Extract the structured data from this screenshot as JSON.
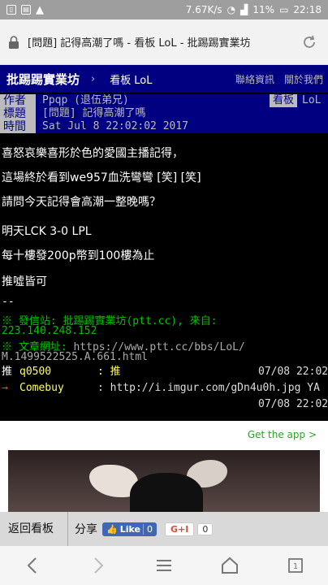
{
  "status": {
    "speed": "7.67K/s",
    "battery": "11%",
    "time": "22:18"
  },
  "browser": {
    "url_title": "[問題] 記得高潮了嗎 - 看板 LoL - 批踢踢實業坊"
  },
  "header": {
    "site": "批踢踢實業坊",
    "sep": "›",
    "board_prefix": "看板",
    "board": "LoL",
    "links": [
      "聯絡資訊",
      "關於我們"
    ]
  },
  "meta": {
    "author_tag": "作者",
    "author": "Ppqp (退伍弟兄)",
    "board_tag": "看板",
    "board": "LoL",
    "title_tag": "標題",
    "title": "[問題] 記得高潮了嗎",
    "time_tag": "時間",
    "time": "Sat Jul  8 22:02:02 2017"
  },
  "body": {
    "lines": [
      "喜怒哀樂喜形於色的愛國主播記得，",
      "這場終於看到we957血洗彎彎 [笑] [笑]",
      "請問今天記得會高潮一整晚嗎？",
      "明天LCK 3-0 LPL",
      "每十樓發200p幣到100樓為止",
      "推噓皆可"
    ],
    "sig": "--",
    "from_line": "※ 發信站: 批踢踢實業坊(ptt.cc), 來自:",
    "ip": "223.140.248.152",
    "url_label": "※ 文章網址:",
    "url": "https://www.ptt.cc/bbs/LoL/",
    "url2": "M.1499522525.A.661.html"
  },
  "pushes": [
    {
      "tag": "推",
      "user": "q0500",
      "text": ": 推",
      "time": "07/08 22:02"
    },
    {
      "tag": "→",
      "user": "Comebuy",
      "text": ": http://i.imgur.com/gDn4u0h.jpg  YA",
      "time": "07/08 22:02"
    }
  ],
  "ad": {
    "get_app": "Get the app >"
  },
  "sharebar": {
    "back": "返回看板",
    "share": "分享",
    "like": "Like",
    "like_count": "0",
    "gplus": "G+I",
    "gplus_count": "0"
  },
  "colors": {
    "header_bg": "#000080",
    "push_user": "#ffff55",
    "green": "#00c000"
  }
}
